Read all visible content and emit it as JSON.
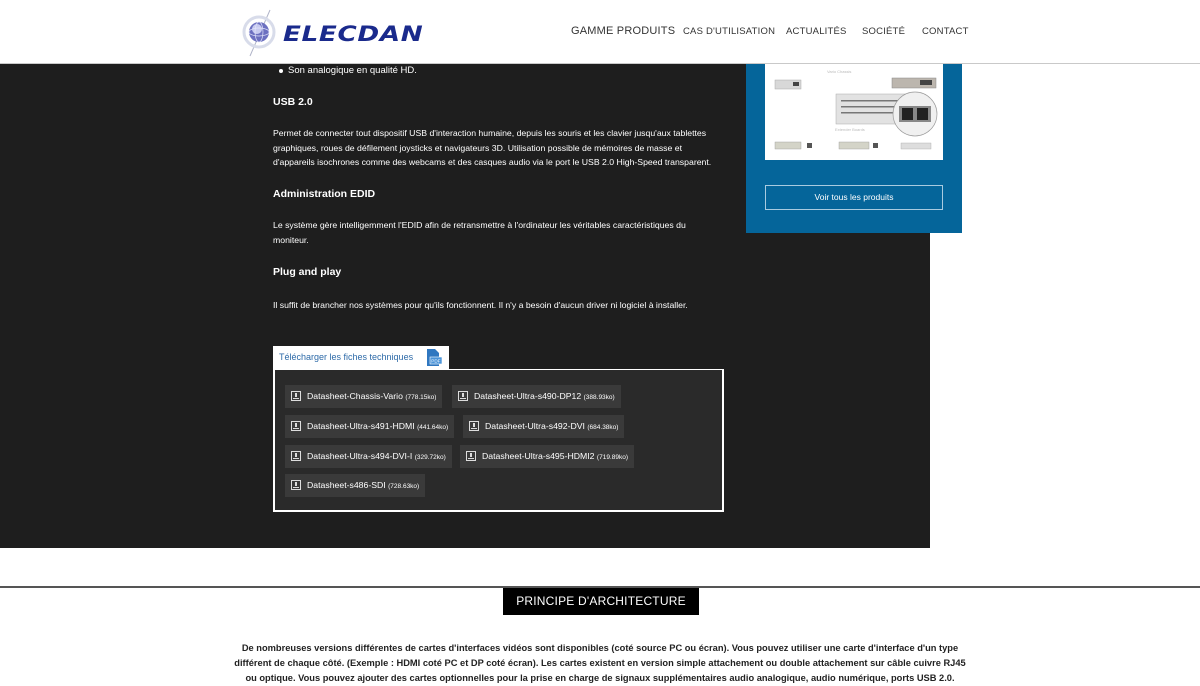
{
  "header": {
    "logo_text": "ELECDAN",
    "nav": [
      {
        "label": "GAMME PRODUITS"
      },
      {
        "label": "CAS D'UTILISATION"
      },
      {
        "label": "ACTUALITÉS"
      },
      {
        "label": "SOCIÉTÉ"
      },
      {
        "label": "CONTACT"
      }
    ]
  },
  "content": {
    "bullet": "Son analogique en qualité HD.",
    "sections": [
      {
        "heading": "USB 2.0",
        "text": "Permet de connecter tout dispositif USB d'interaction humaine, depuis les souris et les clavier jusqu'aux tablettes graphiques, roues de défilement joysticks et navigateurs 3D. Utilisation possible de mémoires de masse et d'appareils isochrones comme des webcams et des casques audio via le port le USB 2.0 High-Speed transparent."
      },
      {
        "heading": "Administration EDID",
        "text": "Le système gère intelligemment l'EDID afin de retransmettre à l'ordinateur les véritables caractéristiques du moniteur."
      },
      {
        "heading": "Plug and play",
        "text": " Il suffit de brancher nos systèmes pour qu'ils fonctionnent. Il n'y a besoin d'aucun driver ni logiciel à installer."
      }
    ]
  },
  "downloads": {
    "tab_label": "Télécharger les fiches techniques",
    "files": [
      {
        "name": "Datasheet-Chassis-Vario",
        "size": "(778.15ko)"
      },
      {
        "name": "Datasheet-Ultra-s490-DP12",
        "size": "(388.93ko)"
      },
      {
        "name": "Datasheet-Ultra-s491-HDMI",
        "size": "(441.64ko)"
      },
      {
        "name": "Datasheet-Ultra-s492-DVI",
        "size": "(684.38ko)"
      },
      {
        "name": "Datasheet-Ultra-s494-DVI-I",
        "size": "(329.72ko)"
      },
      {
        "name": "Datasheet-Ultra-s495-HDMI2",
        "size": "(719.89ko)"
      },
      {
        "name": "Datasheet-s486-SDI",
        "size": "(728.63ko)"
      }
    ]
  },
  "sidebar": {
    "image_caption_top": "Vario Chassis",
    "image_caption_mid": "Extender Boards",
    "button_label": "Voir tous les produits"
  },
  "architecture": {
    "title": "PRINCIPE D'ARCHITECTURE",
    "text": "De nombreuses versions différentes de cartes d'interfaces vidéos sont disponibles (coté source PC ou écran). Vous pouvez utiliser une carte d'interface d'un type différent de chaque côté. (Exemple : HDMI coté PC et DP coté écran). Les cartes existent en version simple attachement ou double attachement sur câble cuivre RJ45 ou optique. Vous pouvez ajouter des cartes optionnelles pour la prise en charge de signaux supplémentaires audio analogique, audio numérique, ports USB 2.0."
  },
  "colors": {
    "brand_blue": "#1a2a8c",
    "sidebar_blue": "#05659a",
    "dark_bg": "#1e1e1e",
    "link_blue": "#2d6aa8"
  }
}
